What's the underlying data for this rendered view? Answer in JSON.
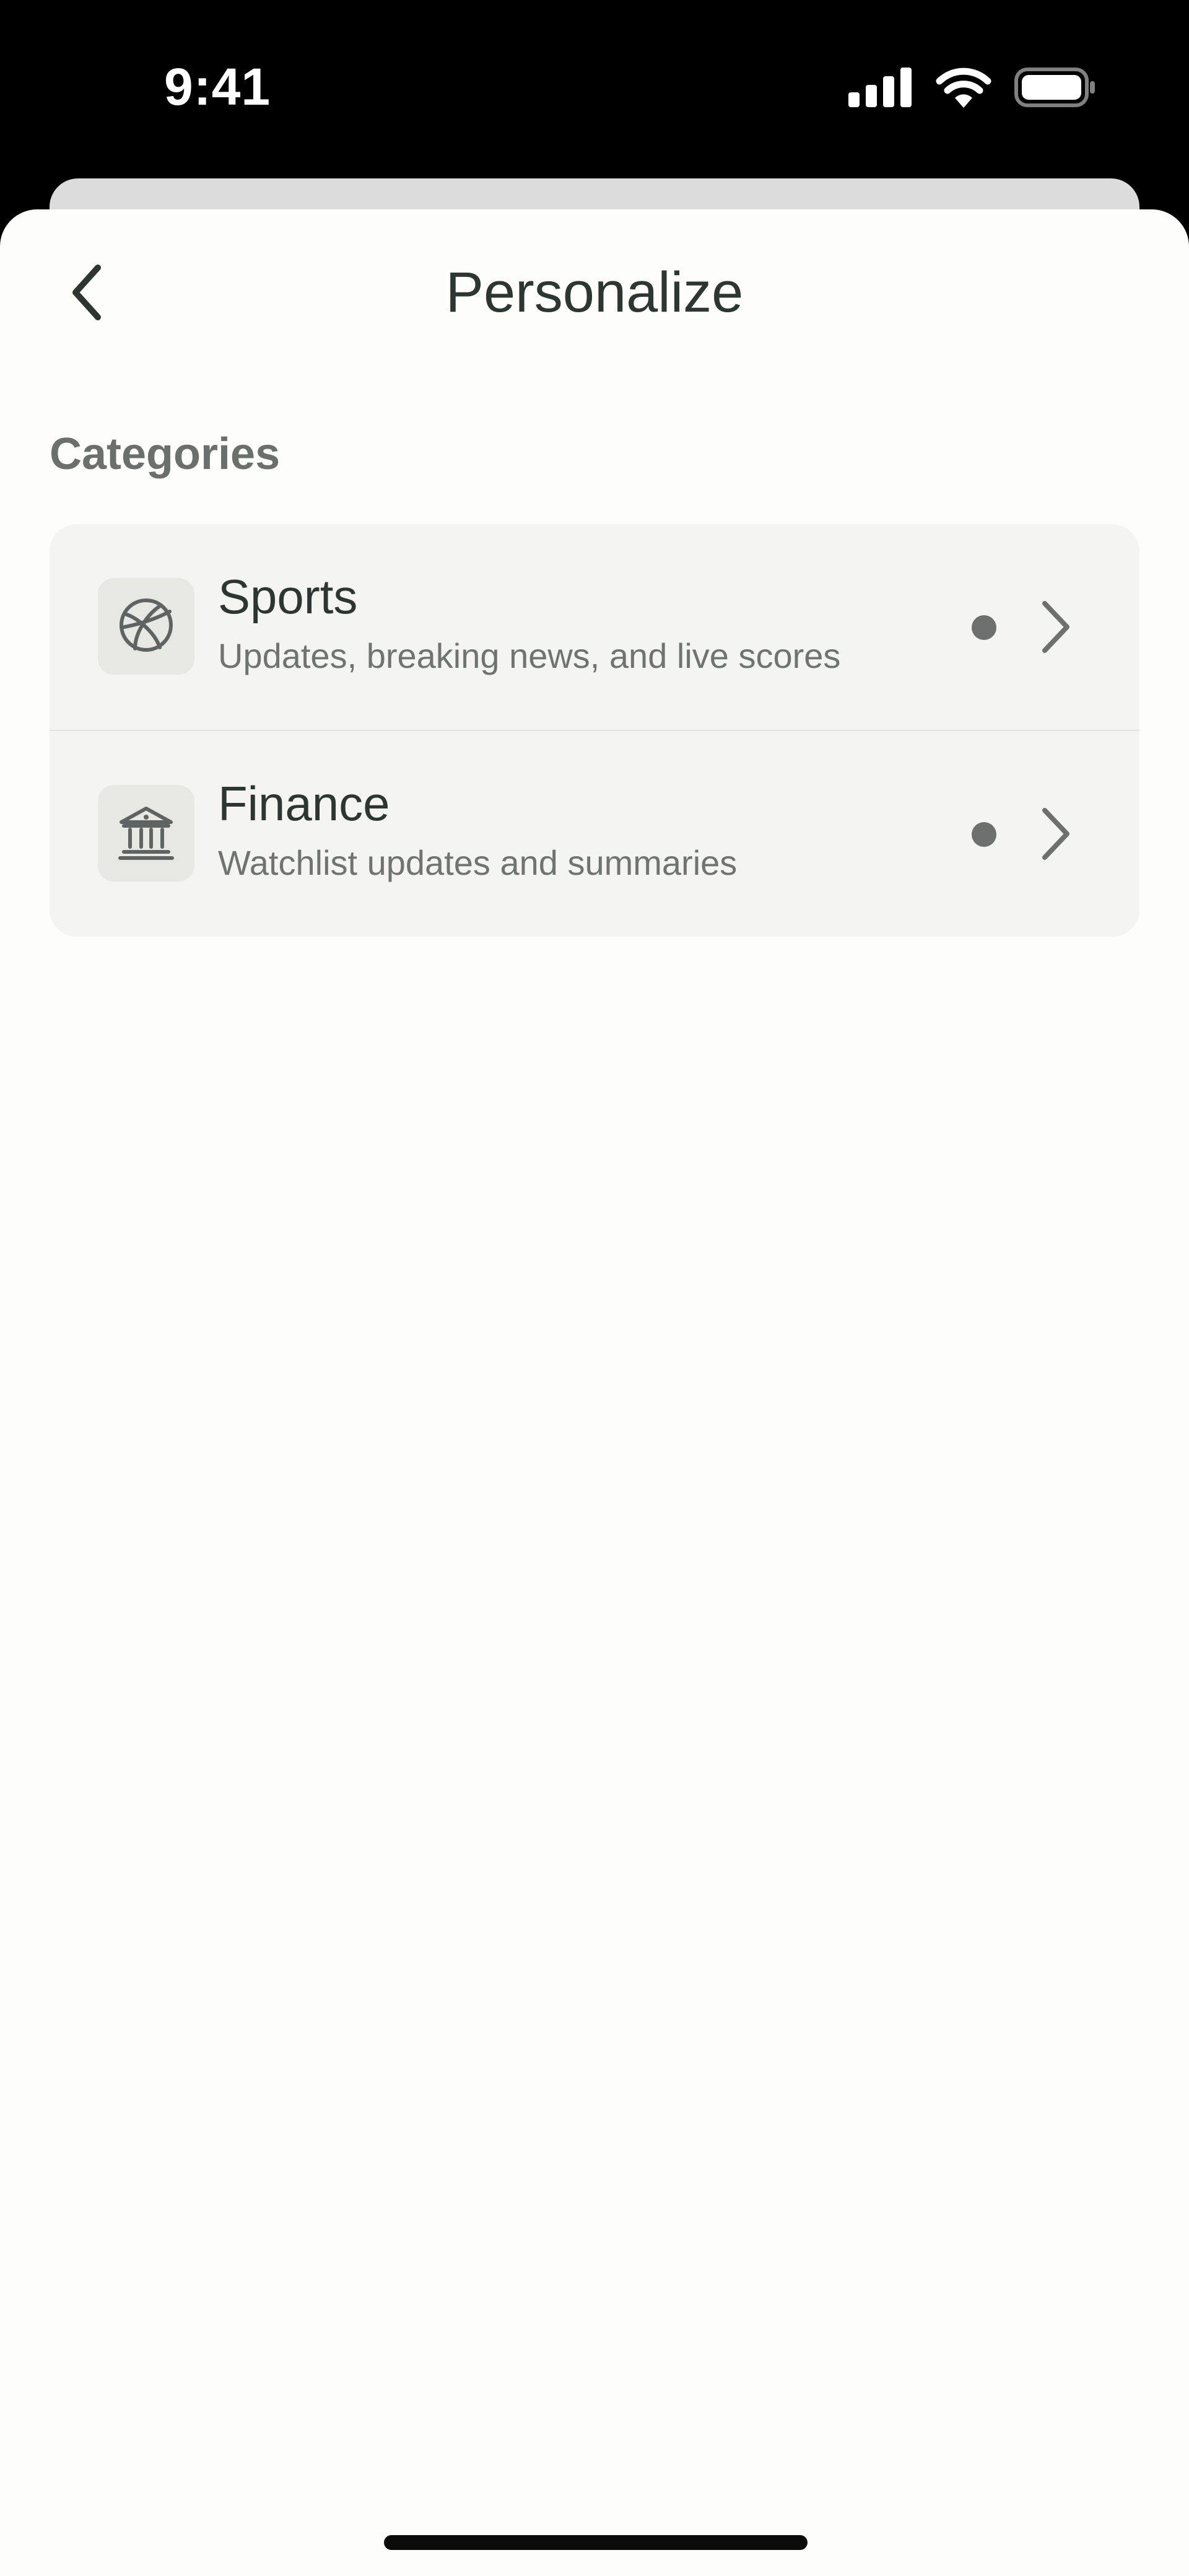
{
  "status_bar": {
    "time": "9:41"
  },
  "nav": {
    "title": "Personalize"
  },
  "section": {
    "header": "Categories"
  },
  "categories": [
    {
      "title": "Sports",
      "subtitle": "Updates, breaking news, and live scores",
      "icon": "basketball-icon"
    },
    {
      "title": "Finance",
      "subtitle": "Watchlist updates and summaries",
      "icon": "bank-icon"
    }
  ],
  "colors": {
    "text_primary": "#2e3634",
    "text_secondary": "#6f7372",
    "card_background": "#f4f4f2",
    "sheet_background": "#fdfdfc",
    "dot": "#6d706f"
  }
}
